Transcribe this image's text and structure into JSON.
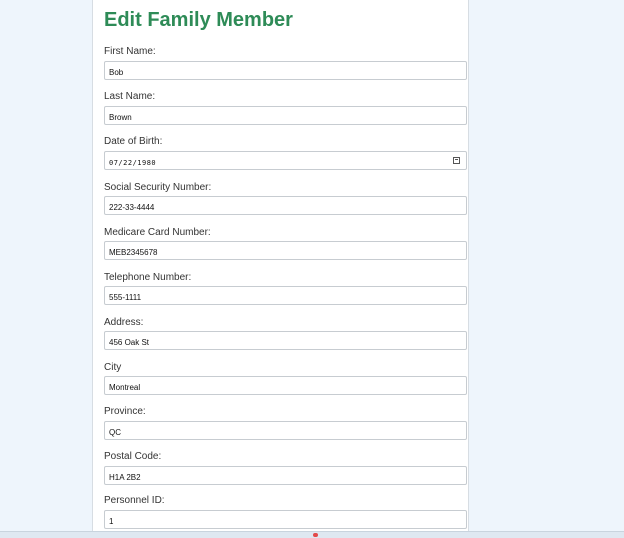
{
  "page": {
    "title": "Edit Family Member"
  },
  "form": {
    "fields": [
      {
        "key": "first_name",
        "label": "First Name:",
        "value": "Bob"
      },
      {
        "key": "last_name",
        "label": "Last Name:",
        "value": "Brown"
      },
      {
        "key": "dob",
        "label": "Date of Birth:",
        "value": "07/22/1980",
        "icon": "calendar-icon"
      },
      {
        "key": "ssn",
        "label": "Social Security Number:",
        "value": "222-33-4444"
      },
      {
        "key": "medicare",
        "label": "Medicare Card Number:",
        "value": "MEB2345678"
      },
      {
        "key": "phone",
        "label": "Telephone Number:",
        "value": "555-1111"
      },
      {
        "key": "address",
        "label": "Address:",
        "value": "456 Oak St"
      },
      {
        "key": "city",
        "label": "City",
        "value": "Montreal"
      },
      {
        "key": "province",
        "label": "Province:",
        "value": "QC"
      },
      {
        "key": "postal",
        "label": "Postal Code:",
        "value": "H1A 2B2"
      },
      {
        "key": "personnel_id",
        "label": "Personnel ID:",
        "value": "1"
      }
    ]
  },
  "colors": {
    "title": "#2e8b57",
    "background": "#eef5fc",
    "card": "#ffffff"
  }
}
